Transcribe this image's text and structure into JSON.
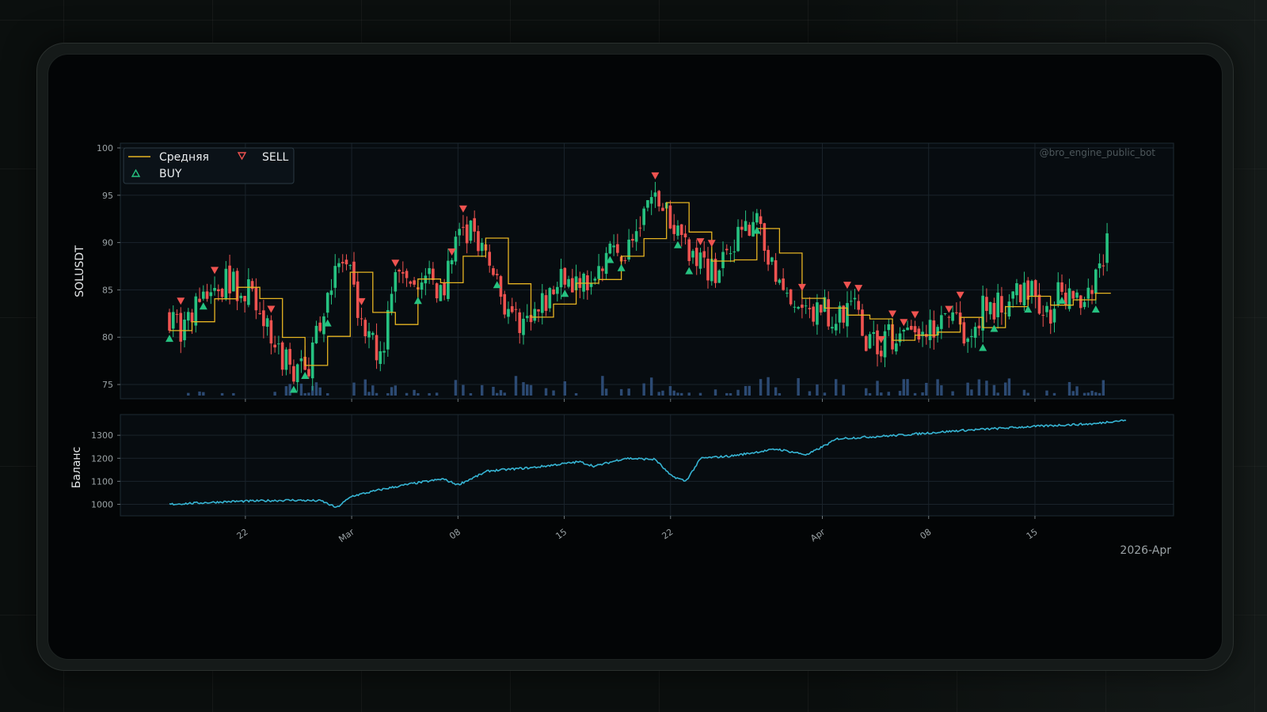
{
  "watermark": "@bro_engine_public_bot",
  "colors": {
    "up": "#26c281",
    "down": "#ef5350",
    "mean": "#e6b422",
    "balance": "#36b4d3",
    "volume": "#2c4a73",
    "panel_bg": "#070c10",
    "grid": "#1a232b"
  },
  "chart_data": [
    {
      "type": "candlestick",
      "ylabel": "SOLUSDT",
      "ylim": [
        73.5,
        100.5
      ],
      "yticks": [
        "75",
        "80",
        "85",
        "90",
        "95",
        "100"
      ],
      "x_range": [
        "2026-02-17",
        "2026-04-21"
      ],
      "legend": {
        "placement": "top-left",
        "entries": [
          {
            "label": "Средняя",
            "icon": "line-icon"
          },
          {
            "label": "SELL",
            "icon": "triangle-down-icon"
          },
          {
            "label": "BUY",
            "icon": "triangle-up-icon"
          }
        ]
      },
      "series_anchor_points": [
        [
          "2026-02-17",
          82.3
        ],
        [
          "2026-02-18",
          80.5
        ],
        [
          "2026-02-19",
          84.0
        ],
        [
          "2026-02-20",
          85.2
        ],
        [
          "2026-02-21",
          85.8
        ],
        [
          "2026-02-22",
          85.0
        ],
        [
          "2026-02-23",
          84.0
        ],
        [
          "2026-02-24",
          78.0
        ],
        [
          "2026-02-25",
          77.0
        ],
        [
          "2026-02-26",
          76.2
        ],
        [
          "2026-02-27",
          82.0
        ],
        [
          "2026-02-28",
          88.0
        ],
        [
          "2026-03-01",
          86.0
        ],
        [
          "2026-03-02",
          80.0
        ],
        [
          "2026-03-03",
          78.0
        ],
        [
          "2026-03-04",
          87.0
        ],
        [
          "2026-03-05",
          84.0
        ],
        [
          "2026-03-06",
          86.0
        ],
        [
          "2026-03-07",
          85.0
        ],
        [
          "2026-03-08",
          90.0
        ],
        [
          "2026-03-09",
          91.5
        ],
        [
          "2026-03-10",
          88.0
        ],
        [
          "2026-03-11",
          84.0
        ],
        [
          "2026-03-12",
          82.0
        ],
        [
          "2026-03-13",
          81.5
        ],
        [
          "2026-03-14",
          84.0
        ],
        [
          "2026-03-15",
          86.0
        ],
        [
          "2026-03-16",
          85.0
        ],
        [
          "2026-03-17",
          87.0
        ],
        [
          "2026-03-18",
          89.0
        ],
        [
          "2026-03-19",
          88.0
        ],
        [
          "2026-03-20",
          92.0
        ],
        [
          "2026-03-21",
          95.0
        ],
        [
          "2026-03-22",
          93.0
        ],
        [
          "2026-03-23",
          90.0
        ],
        [
          "2026-03-24",
          88.5
        ],
        [
          "2026-03-25",
          87.0
        ],
        [
          "2026-03-26",
          90.0
        ],
        [
          "2026-03-27",
          91.5
        ],
        [
          "2026-03-28",
          92.0
        ],
        [
          "2026-03-29",
          86.0
        ],
        [
          "2026-03-30",
          83.0
        ],
        [
          "2026-03-31",
          82.5
        ],
        [
          "2026-04-01",
          83.0
        ],
        [
          "2026-04-02",
          82.0
        ],
        [
          "2026-04-03",
          84.0
        ],
        [
          "2026-04-04",
          80.0
        ],
        [
          "2026-04-05",
          79.0
        ],
        [
          "2026-04-06",
          80.5
        ],
        [
          "2026-04-07",
          81.0
        ],
        [
          "2026-04-08",
          80.0
        ],
        [
          "2026-04-09",
          81.0
        ],
        [
          "2026-04-10",
          82.5
        ],
        [
          "2026-04-11",
          79.0
        ],
        [
          "2026-04-12",
          84.0
        ],
        [
          "2026-04-13",
          83.0
        ],
        [
          "2026-04-14",
          85.0
        ],
        [
          "2026-04-15",
          84.5
        ],
        [
          "2026-04-16",
          82.0
        ],
        [
          "2026-04-17",
          85.0
        ],
        [
          "2026-04-18",
          84.0
        ],
        [
          "2026-04-19",
          85.5
        ],
        [
          "2026-04-20",
          89.5
        ]
      ]
    },
    {
      "type": "line",
      "ylabel": "Баланс",
      "ylim": [
        950,
        1390
      ],
      "yticks": [
        "1000",
        "1100",
        "1200",
        "1300"
      ],
      "series_anchor_points": [
        [
          "2026-02-17",
          1000
        ],
        [
          "2026-02-21",
          1012
        ],
        [
          "2026-02-25",
          1018
        ],
        [
          "2026-02-27",
          1015
        ],
        [
          "2026-02-28",
          985
        ],
        [
          "2026-03-01",
          1035
        ],
        [
          "2026-03-03",
          1065
        ],
        [
          "2026-03-05",
          1090
        ],
        [
          "2026-03-07",
          1110
        ],
        [
          "2026-03-08",
          1085
        ],
        [
          "2026-03-10",
          1145
        ],
        [
          "2026-03-13",
          1160
        ],
        [
          "2026-03-16",
          1185
        ],
        [
          "2026-03-17",
          1165
        ],
        [
          "2026-03-19",
          1200
        ],
        [
          "2026-03-21",
          1195
        ],
        [
          "2026-03-22",
          1125
        ],
        [
          "2026-03-23",
          1100
        ],
        [
          "2026-03-24",
          1200
        ],
        [
          "2026-03-26",
          1210
        ],
        [
          "2026-03-29",
          1240
        ],
        [
          "2026-03-31",
          1215
        ],
        [
          "2026-04-02",
          1285
        ],
        [
          "2026-04-06",
          1300
        ],
        [
          "2026-04-10",
          1320
        ],
        [
          "2026-04-14",
          1335
        ],
        [
          "2026-04-17",
          1345
        ],
        [
          "2026-04-19",
          1350
        ],
        [
          "2026-04-20",
          1360
        ],
        [
          "2026-04-21",
          1365
        ]
      ]
    }
  ],
  "x_axis": {
    "ticks": [
      {
        "label": "22",
        "date": "2026-02-22"
      },
      {
        "label": "Mar",
        "date": "2026-03-01"
      },
      {
        "label": "08",
        "date": "2026-03-08"
      },
      {
        "label": "15",
        "date": "2026-03-15"
      },
      {
        "label": "22",
        "date": "2026-03-22"
      },
      {
        "label": "Apr",
        "date": "2026-04-01"
      },
      {
        "label": "08",
        "date": "2026-04-08"
      },
      {
        "label": "15",
        "date": "2026-04-15"
      }
    ],
    "offset_label": "2026-Apr"
  }
}
